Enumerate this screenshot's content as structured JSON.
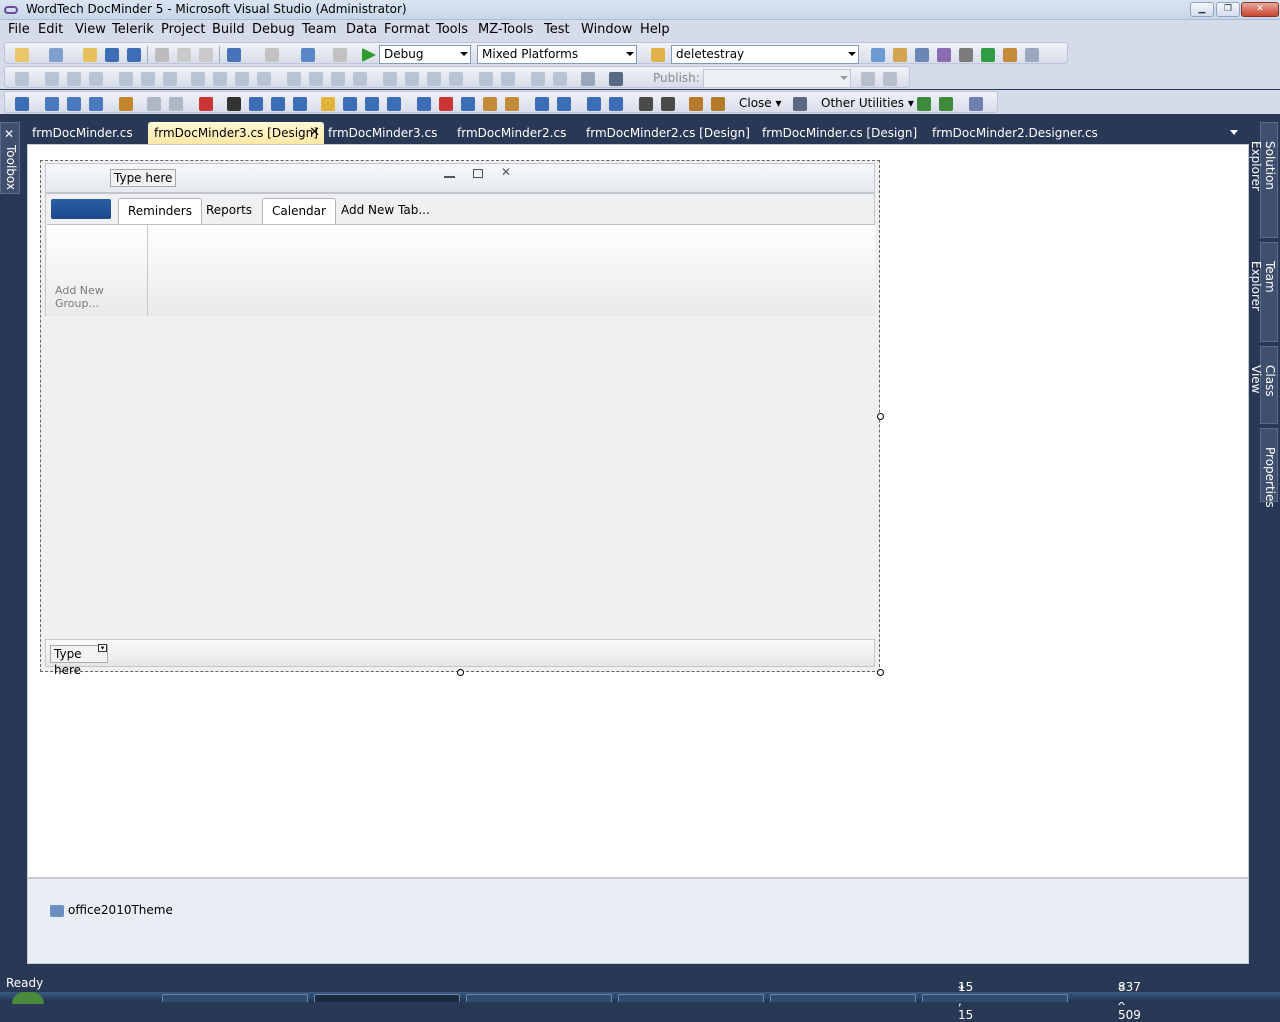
{
  "window": {
    "title": "WordTech DocMinder 5 - Microsoft Visual Studio (Administrator)",
    "controls": {
      "minimize": "▁",
      "maximize": "❐",
      "close": "✕"
    }
  },
  "menu": [
    "File",
    "Edit",
    "View",
    "Telerik",
    "Project",
    "Build",
    "Debug",
    "Team",
    "Data",
    "Format",
    "Tools",
    "MZ-Tools",
    "Test",
    "Window",
    "Help"
  ],
  "toolbar": {
    "config": "Debug",
    "platform": "Mixed Platforms",
    "find": "deletestray",
    "publish_label": "Publish:",
    "close_label": "Close",
    "other_utilities": "Other Utilities"
  },
  "left_panel": {
    "toolbox": "Toolbox"
  },
  "right_panels": [
    "Solution Explorer",
    "Team Explorer",
    "Class View",
    "Properties"
  ],
  "doc_tabs": [
    {
      "label": "frmDocMinder.cs",
      "active": false
    },
    {
      "label": "frmDocMinder3.cs [Design]",
      "active": true
    },
    {
      "label": "frmDocMinder3.cs",
      "active": false
    },
    {
      "label": "frmDocMinder2.cs",
      "active": false
    },
    {
      "label": "frmDocMinder2.cs [Design]",
      "active": false
    },
    {
      "label": "frmDocMinder.cs [Design]",
      "active": false
    },
    {
      "label": "frmDocMinder2.Designer.cs",
      "active": false
    }
  ],
  "form": {
    "title_typehere": "Type here",
    "ribbon_tabs": [
      "Reminders",
      "Reports",
      "Calendar",
      "Add New Tab..."
    ],
    "group_add": "Add New Group...",
    "status_typehere": "Type here"
  },
  "components": [
    "office2010Theme"
  ],
  "statusbar": {
    "ready": "Ready",
    "position": "15 , 15",
    "size": "837 x 509"
  }
}
